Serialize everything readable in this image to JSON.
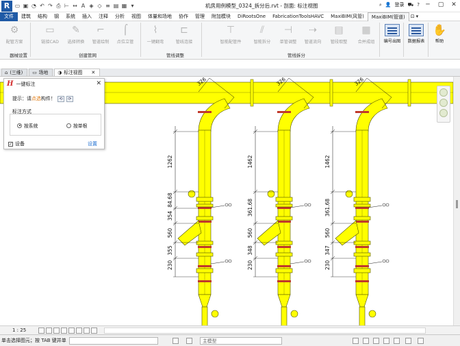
{
  "app": {
    "title": "机房用例模型_0324_拆分后.rvt - 剖面: 标注视图",
    "logo": "R",
    "user": "登录",
    "help_glyph": "?"
  },
  "menu_tabs": [
    "文件",
    "建筑",
    "结构",
    "钢",
    "系统",
    "插入",
    "注释",
    "分析",
    "视图",
    "体量和场地",
    "协作",
    "管理",
    "附加模块",
    "DiRootsOne",
    "FabricationToolsHAVC",
    "MaxiBIM(风管)",
    "MaxiBIM(管道)"
  ],
  "ribbon": {
    "tools": [
      {
        "label": "配管方案",
        "icon": "pipe-plan-icon"
      },
      {
        "label": "链接CAD",
        "icon": "link-cad-icon"
      },
      {
        "label": "选择转换",
        "icon": "convert-icon"
      },
      {
        "label": "管道绘制",
        "icon": "pipe-draw-icon"
      },
      {
        "label": "点位立管",
        "icon": "riser-icon"
      },
      {
        "label": "一键翻弯",
        "icon": "bend-icon"
      },
      {
        "label": "管线连接",
        "icon": "connect-icon"
      },
      {
        "label": "智能配管件",
        "icon": "fitting-icon"
      },
      {
        "label": "智能拆分",
        "icon": "split-icon"
      },
      {
        "label": "单管调整",
        "icon": "single-adjust-icon"
      },
      {
        "label": "管道流向",
        "icon": "flow-icon"
      },
      {
        "label": "管段取整",
        "icon": "round-icon"
      },
      {
        "label": "合并成组",
        "icon": "group-icon"
      },
      {
        "label": "编号出图",
        "icon": "numbering-icon"
      },
      {
        "label": "数据报表",
        "icon": "report-icon"
      },
      {
        "label": "帮助",
        "icon": "help-icon"
      }
    ],
    "groups": [
      "器械设置",
      "创建管网",
      "管线调整",
      "管线拆分"
    ]
  },
  "doc_tabs": [
    {
      "label": "(三维)",
      "active": false
    },
    {
      "label": "场地",
      "active": false
    },
    {
      "label": "标注视图",
      "active": true
    }
  ],
  "dialog": {
    "title": "一键标注",
    "logo": "H",
    "hint_prefix": "提示：请",
    "hint_highlight": "点选",
    "hint_suffix": "构件！",
    "section": "标注方式",
    "options": [
      "按系统",
      "按单根"
    ],
    "selected_option": "按系统",
    "checkbox_label": "设备",
    "checkbox_checked": true,
    "settings_link": "设置"
  },
  "drawing": {
    "pipe_color": "#ffff00",
    "outline_color": "#4d4d00",
    "band_color": "#c0392b",
    "columns": [
      {
        "top_dim": "326",
        "dims": [
          "1262",
          "84.68",
          "354",
          "560",
          "355",
          "230"
        ]
      },
      {
        "top_dim": "326",
        "dims": [
          "1462",
          "361.68",
          "560",
          "348",
          "230"
        ]
      },
      {
        "top_dim": "326",
        "dims": [
          "1462",
          "361.68",
          "560",
          "347",
          "230"
        ]
      }
    ]
  },
  "viewbar": {
    "scale": "1 : 25"
  },
  "statusbar": {
    "text": "单击选择图元；按 TAB 键并单",
    "model": "主模型"
  }
}
